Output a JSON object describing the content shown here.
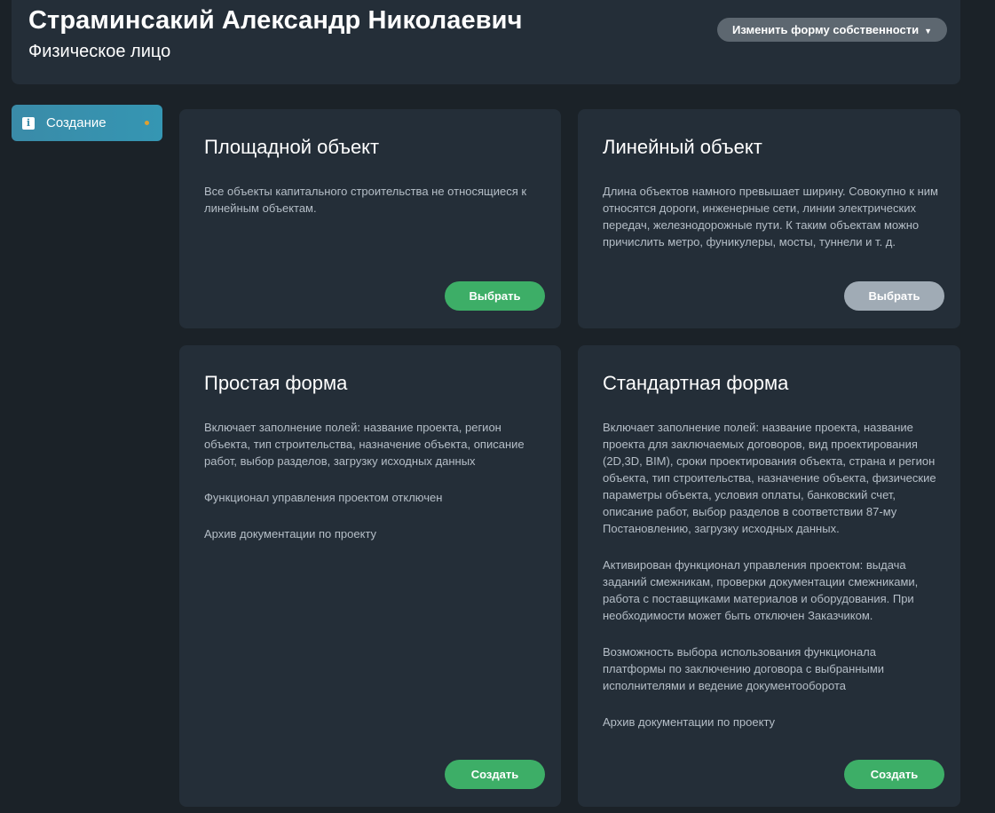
{
  "header": {
    "name": "Страминсакий Александр Николаевич",
    "type": "Физическое лицо",
    "owner_button": "Изменить форму собственности"
  },
  "sidebar": {
    "items": [
      {
        "label": "Создание",
        "icon": "info-icon",
        "active": true
      }
    ]
  },
  "cards": [
    {
      "title": "Площадной объект",
      "paragraphs": [
        "Все объекты капитального строительства не относящиеся к линейным объектам."
      ],
      "button": "Выбрать",
      "button_state": "active"
    },
    {
      "title": "Линейный объект",
      "paragraphs": [
        "Длина объектов намного превышает ширину. Совокупно к ним относятся дороги, инженерные сети, линии электрических передач, железнодорожные пути. К таким объектам можно причислить метро, фуникулеры, мосты, туннели и т. д."
      ],
      "button": "Выбрать",
      "button_state": "inactive"
    },
    {
      "title": "Простая форма",
      "paragraphs": [
        "Включает заполнение полей: название проекта, регион объекта, тип строительства, назначение объекта, описание работ, выбор разделов, загрузку исходных данных",
        "Функционал управления проектом отключен",
        "Архив документации по проекту"
      ],
      "button": "Создать",
      "button_state": "active"
    },
    {
      "title": "Стандартная форма",
      "paragraphs": [
        "Включает заполнение полей: название проекта, название проекта для заключаемых договоров, вид проектирования (2D,3D, BIM), сроки проектирования объекта, страна и регион объекта, тип строительства, назначение объекта, физические параметры объекта, условия оплаты, банковский счет, описание работ, выбор разделов в соответствии 87-му Постановлению, загрузку исходных данных.",
        "Активирован функционал управления проектом: выдача заданий смежникам, проверки документации смежниками, работа с поставщиками материалов и оборудования. При необходимости может быть отключен Заказчиком.",
        "Возможность выбора использования функционала платформы по заключению договора с выбранными исполнителями и ведение документооборота",
        "Архив документации по проекту"
      ],
      "button": "Создать",
      "button_state": "active"
    }
  ],
  "colors": {
    "background": "#1b2228",
    "panel": "#242e38",
    "accent": "#3a8ba8",
    "button_green": "#3dae67",
    "button_gray": "#a0abb5",
    "indicator": "#e0a030"
  }
}
